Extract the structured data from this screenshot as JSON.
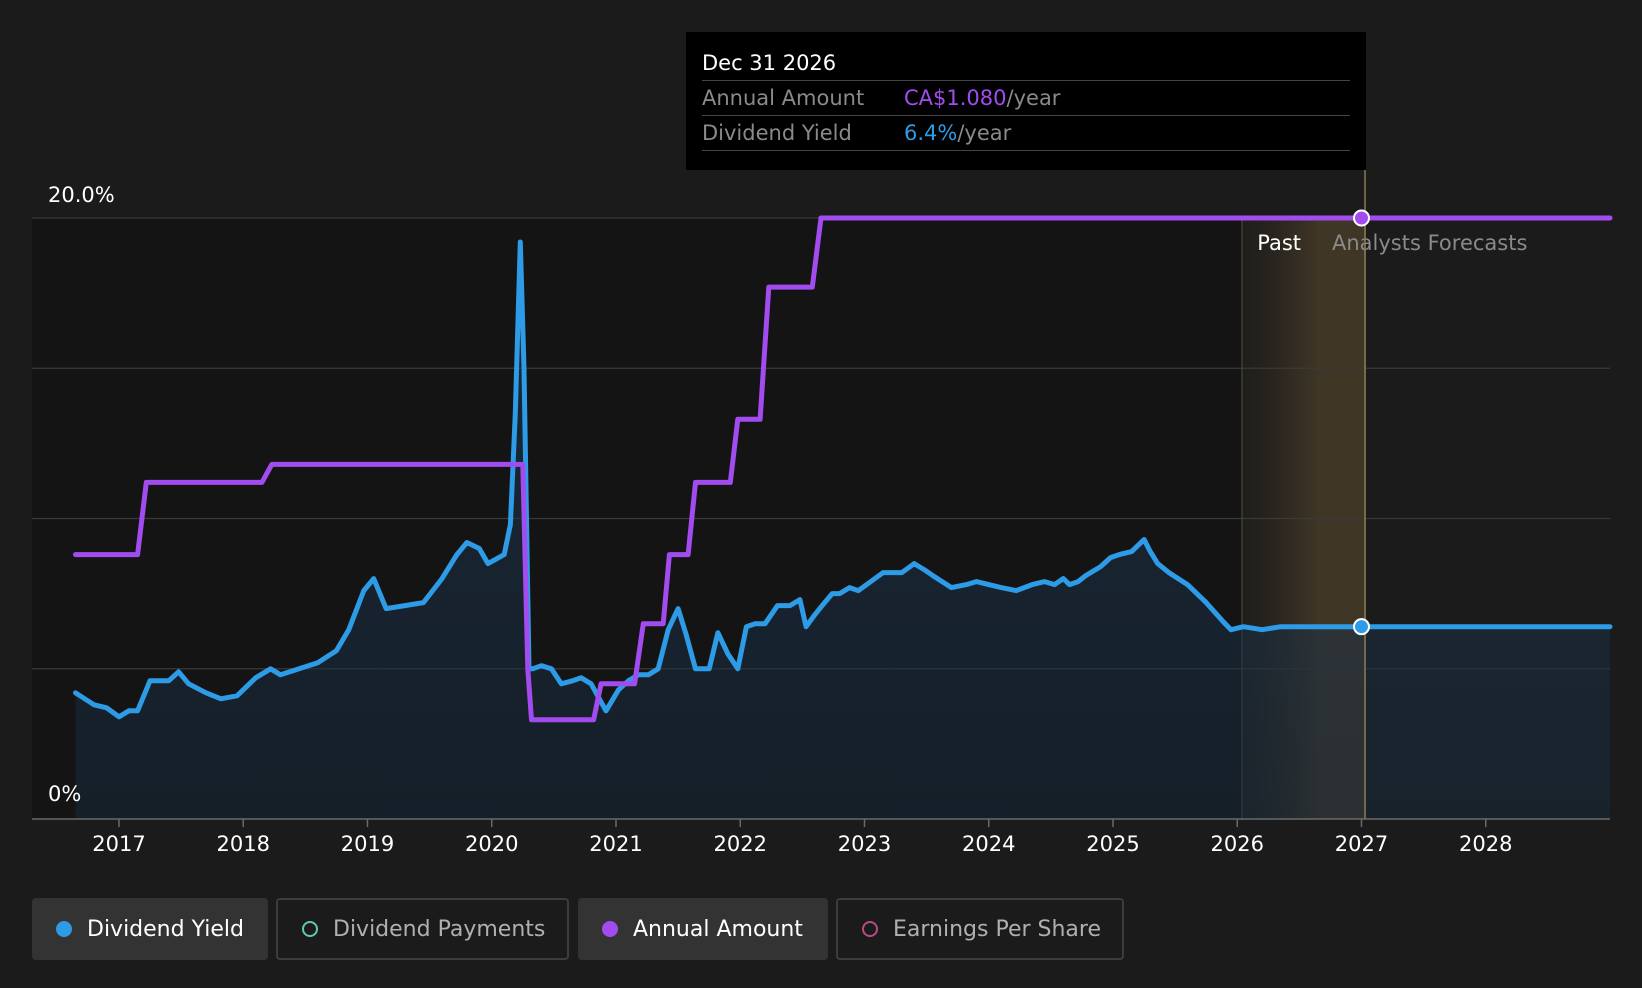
{
  "tooltip": {
    "date": "Dec 31 2026",
    "rows": [
      {
        "label": "Annual Amount",
        "value": "CA$1.080",
        "unit": "/year",
        "color": "#a24cf0"
      },
      {
        "label": "Dividend Yield",
        "value": "6.4%",
        "unit": "/year",
        "color": "#2d9be6"
      }
    ]
  },
  "legend": [
    {
      "label": "Dividend Yield",
      "color": "#2d9be6",
      "active": true,
      "icon": "filled-dot"
    },
    {
      "label": "Dividend Payments",
      "color": "#5fc9b0",
      "active": false,
      "icon": "ring-dot"
    },
    {
      "label": "Annual Amount",
      "color": "#a24cf0",
      "active": true,
      "icon": "filled-dot"
    },
    {
      "label": "Earnings Per Share",
      "color": "#b94a86",
      "active": false,
      "icon": "ring-dot"
    }
  ],
  "colors": {
    "yield": "#2d9be6",
    "amount": "#a24cf0",
    "background": "#1b1b1b",
    "forecast_band": "#5a4a2e"
  },
  "chart_data": {
    "type": "line",
    "yticks": [
      "0%",
      "20.0%"
    ],
    "ylim": [
      0,
      20
    ],
    "xlim": [
      2016.3,
      2029.0
    ],
    "xticks": [
      "2017",
      "2018",
      "2019",
      "2020",
      "2021",
      "2022",
      "2023",
      "2024",
      "2025",
      "2026",
      "2027",
      "2028"
    ],
    "regions": {
      "past_label": "Past",
      "forecast_label": "Analysts Forecasts",
      "divider_x": 2027.0
    },
    "grid": true,
    "series": [
      {
        "name": "Dividend Yield",
        "color": "#2d9be6",
        "area": true,
        "x": [
          2016.65,
          2016.8,
          2016.9,
          2017.0,
          2017.08,
          2017.15,
          2017.25,
          2017.4,
          2017.48,
          2017.56,
          2017.7,
          2017.82,
          2017.95,
          2018.1,
          2018.22,
          2018.3,
          2018.45,
          2018.6,
          2018.75,
          2018.85,
          2018.97,
          2019.05,
          2019.15,
          2019.3,
          2019.45,
          2019.6,
          2019.72,
          2019.8,
          2019.9,
          2019.97,
          2020.1,
          2020.15,
          2020.19,
          2020.23,
          2020.26,
          2020.3,
          2020.33,
          2020.4,
          2020.48,
          2020.56,
          2020.65,
          2020.72,
          2020.8,
          2020.92,
          2021.02,
          2021.1,
          2021.18,
          2021.26,
          2021.34,
          2021.42,
          2021.5,
          2021.56,
          2021.64,
          2021.75,
          2021.82,
          2021.9,
          2021.98,
          2022.05,
          2022.12,
          2022.2,
          2022.3,
          2022.4,
          2022.48,
          2022.53,
          2022.6,
          2022.66,
          2022.74,
          2022.8,
          2022.88,
          2022.95,
          2023.05,
          2023.15,
          2023.22,
          2023.3,
          2023.4,
          2023.48,
          2023.55,
          2023.7,
          2023.82,
          2023.9,
          2024.1,
          2024.22,
          2024.35,
          2024.45,
          2024.53,
          2024.6,
          2024.65,
          2024.72,
          2024.78,
          2024.9,
          2024.98,
          2025.05,
          2025.15,
          2025.25,
          2025.3,
          2025.36,
          2025.45,
          2025.6,
          2025.75,
          2025.88,
          2025.95,
          2026.05,
          2026.2,
          2026.35,
          2026.45,
          2026.6,
          2027.0,
          2028.0,
          2029.0
        ],
        "values": [
          4.2,
          3.8,
          3.7,
          3.4,
          3.6,
          3.6,
          4.6,
          4.6,
          4.9,
          4.5,
          4.2,
          4.0,
          4.1,
          4.7,
          5.0,
          4.8,
          5.0,
          5.2,
          5.6,
          6.3,
          7.6,
          8.0,
          7.0,
          7.1,
          7.2,
          8.0,
          8.8,
          9.2,
          9.0,
          8.5,
          8.8,
          9.8,
          13.5,
          19.2,
          15.0,
          5.0,
          5.0,
          5.1,
          5.0,
          4.5,
          4.6,
          4.7,
          4.5,
          3.6,
          4.3,
          4.6,
          4.8,
          4.8,
          5.0,
          6.3,
          7.0,
          6.2,
          5.0,
          5.0,
          6.2,
          5.5,
          5.0,
          6.4,
          6.5,
          6.5,
          7.1,
          7.1,
          7.3,
          6.4,
          6.8,
          7.1,
          7.5,
          7.5,
          7.7,
          7.6,
          7.9,
          8.2,
          8.2,
          8.2,
          8.5,
          8.3,
          8.1,
          7.7,
          7.8,
          7.9,
          7.7,
          7.6,
          7.8,
          7.9,
          7.8,
          8.0,
          7.8,
          7.9,
          8.1,
          8.4,
          8.7,
          8.8,
          8.9,
          9.3,
          8.9,
          8.5,
          8.2,
          7.8,
          7.2,
          6.6,
          6.3,
          6.4,
          6.3,
          6.4,
          6.4,
          6.4,
          6.4,
          6.4,
          6.4
        ]
      },
      {
        "name": "Annual Amount",
        "color": "#a24cf0",
        "area": false,
        "x": [
          2016.65,
          2017.15,
          2017.22,
          2017.35,
          2018.15,
          2018.23,
          2018.5,
          2020.25,
          2020.29,
          2020.32,
          2020.82,
          2020.88,
          2021.15,
          2021.22,
          2021.38,
          2021.43,
          2021.58,
          2021.64,
          2021.92,
          2021.98,
          2022.16,
          2022.23,
          2022.58,
          2022.65,
          2023.0,
          2027.0,
          2029.0
        ],
        "values": [
          8.8,
          8.8,
          11.2,
          11.2,
          11.2,
          11.8,
          11.8,
          11.8,
          5.0,
          3.3,
          3.3,
          4.5,
          4.5,
          6.5,
          6.5,
          8.8,
          8.8,
          11.2,
          11.2,
          13.3,
          13.3,
          17.7,
          17.7,
          20.0,
          20.0,
          20.0,
          20.0
        ]
      }
    ],
    "highlight": {
      "x": 2027.0,
      "yield": 6.4,
      "amount": 20.0
    }
  }
}
